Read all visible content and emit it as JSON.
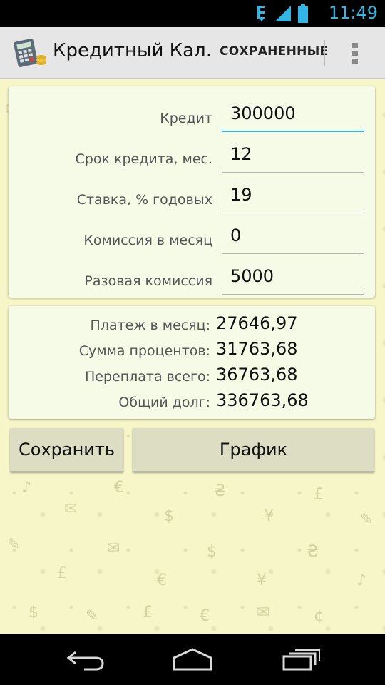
{
  "status_bar": {
    "time": "11:49",
    "icons": [
      "usb-debug-icon",
      "signal-icon",
      "battery-icon"
    ],
    "accent_color": "#33b5e5"
  },
  "action_bar": {
    "app_icon": "calculator-coins-icon",
    "title": "Кредитный Кал…",
    "saved_label": "СОХРАНЕННЫЕ",
    "overflow_icon": "overflow-menu-icon"
  },
  "form": {
    "fields": [
      {
        "label": "Кредит",
        "value": "300000"
      },
      {
        "label": "Срок кредита, мес.",
        "value": "12"
      },
      {
        "label": "Ставка, % годовых",
        "value": "19"
      },
      {
        "label": "Комиссия в месяц",
        "value": "0"
      },
      {
        "label": "Разовая комиссия",
        "value": "5000"
      }
    ],
    "focused_index": 0
  },
  "results": [
    {
      "label": "Платеж в месяц:",
      "value": "27646,97"
    },
    {
      "label": "Сумма процентов:",
      "value": "31763,68"
    },
    {
      "label": "Переплата всего:",
      "value": "36763,68"
    },
    {
      "label": "Общий долг:",
      "value": "336763,68"
    }
  ],
  "buttons": {
    "save_label": "Сохранить",
    "graph_label": "График"
  },
  "nav_bar": {
    "icons": [
      "back-icon",
      "home-icon",
      "recent-apps-icon"
    ]
  },
  "colors": {
    "background": "#f7f6c8",
    "card": "#f6fbe7",
    "button": "#ddddc4"
  }
}
